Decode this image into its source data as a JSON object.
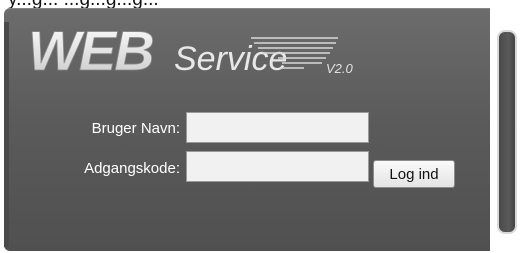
{
  "header": {
    "strip_text": "y...g... ...g...g...g..."
  },
  "logo": {
    "web_text": "WEB",
    "service_text": "Service",
    "version_text": "V2.0"
  },
  "login_form": {
    "username_label": "Bruger Navn:",
    "username_value": "",
    "password_label": "Adgangskode:",
    "password_value": "",
    "login_button_label": "Log ind"
  },
  "colors": {
    "panel_bg": "#5e5e5e",
    "label_text": "#ffffff",
    "input_bg": "#f1f1f1",
    "logo_text": "#e6e6e6"
  }
}
